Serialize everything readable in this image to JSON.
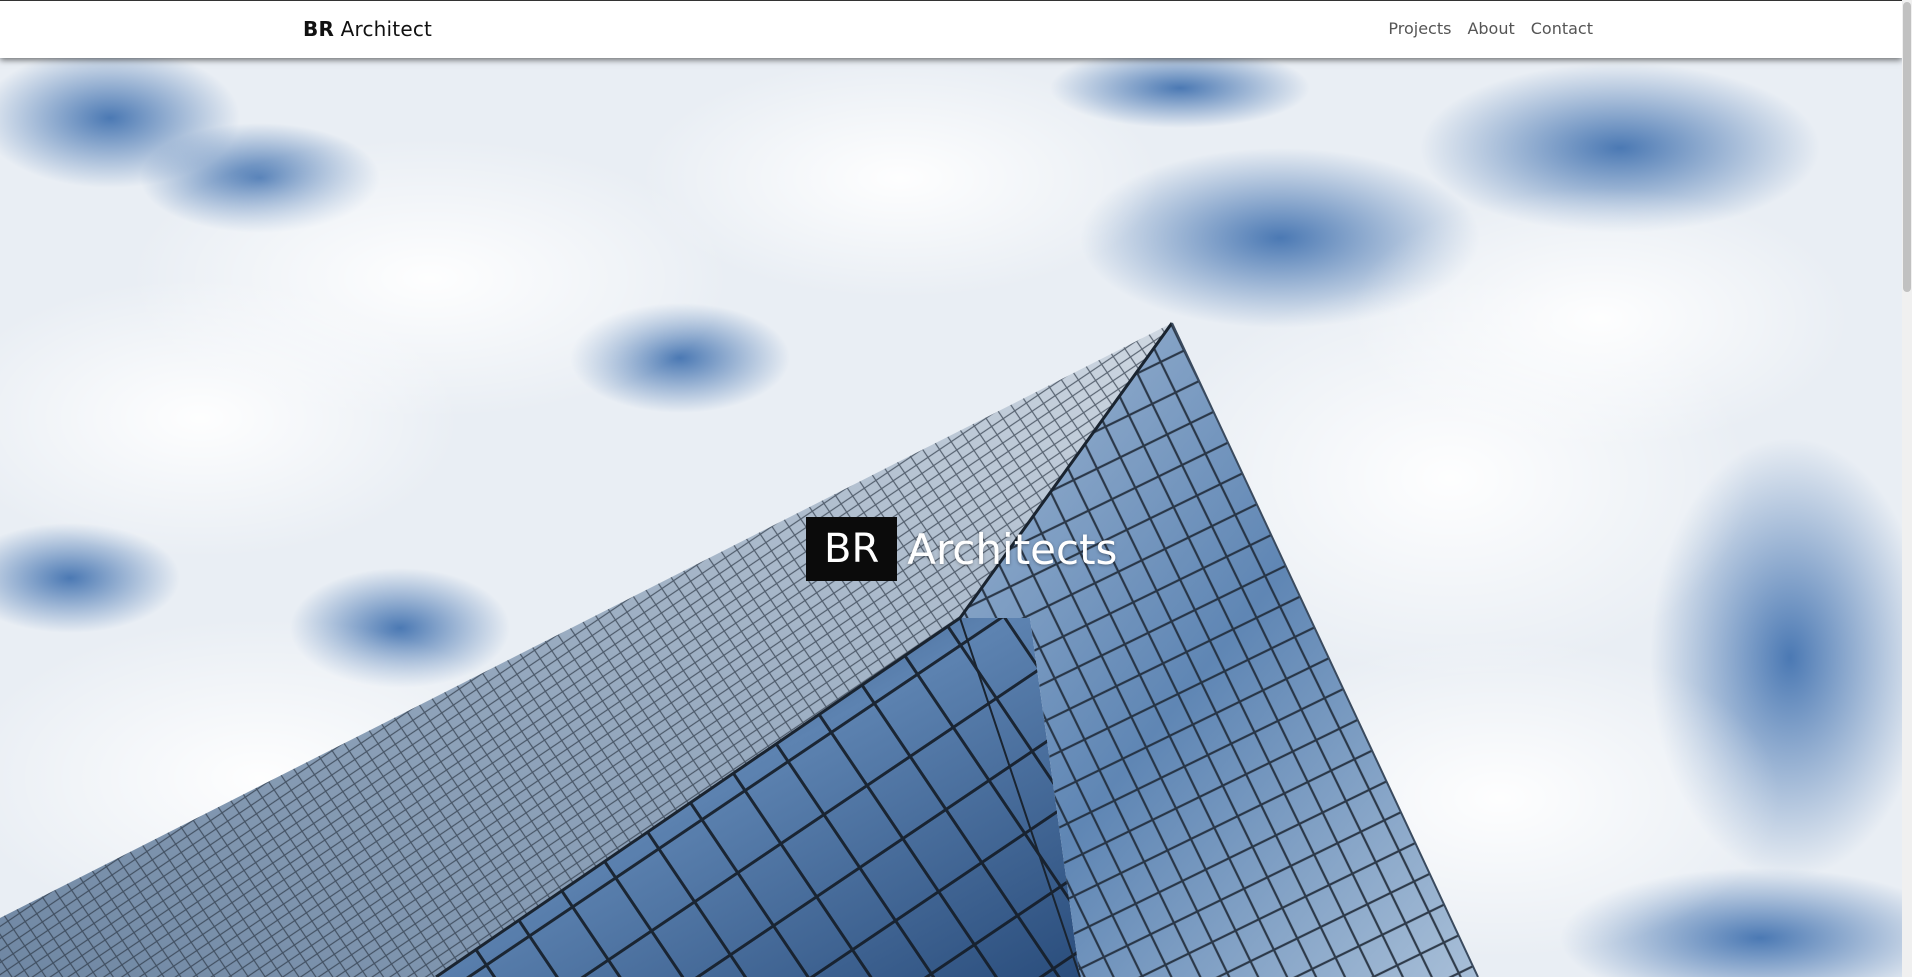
{
  "navbar": {
    "brand_strong": "BR",
    "brand_rest": " Architect",
    "links": [
      "Projects",
      "About",
      "Contact"
    ]
  },
  "hero": {
    "mark": "BR",
    "word": "Architects",
    "background": "sky with clouds and a glass skyscraper seen from below"
  },
  "colors": {
    "nav_bg": "#ffffff",
    "nav_link": "#555555",
    "mark_bg": "#0b0b0b",
    "hero_text": "#ffffff"
  }
}
